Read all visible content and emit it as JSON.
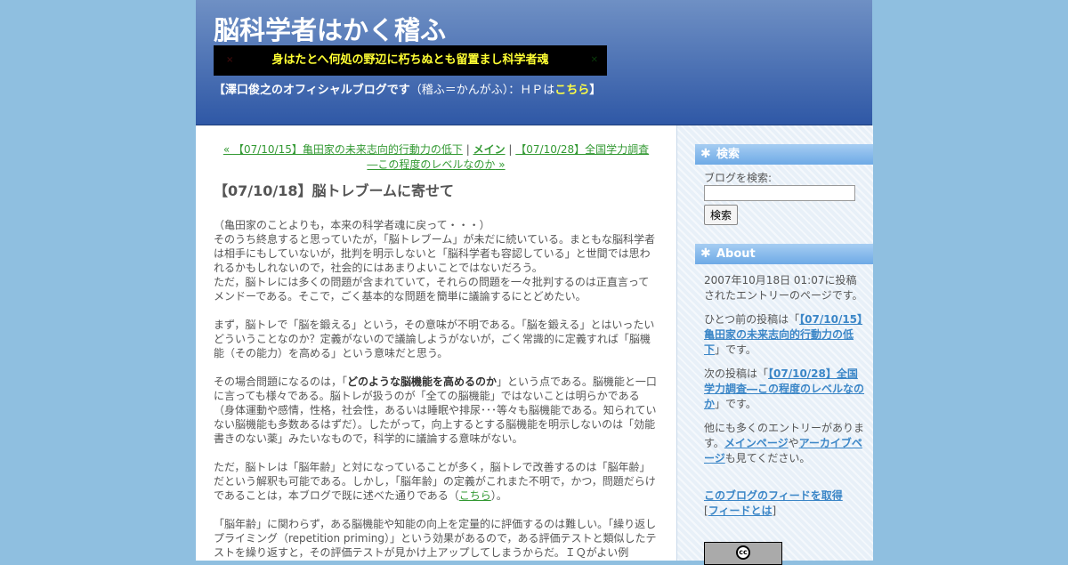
{
  "header": {
    "title": "脳科学者はかく稽ふ",
    "tagline": "身はたとへ何処の野辺に朽ちぬとも留置まし科学者魂",
    "tagline_left_mark": "×",
    "tagline_right_mark": "✕",
    "subtitle_bold": "【澤口俊之のオフィシャルブログです",
    "subtitle_text": "（稽ふ＝かんがふ）：ＨＰは",
    "subtitle_link": "こちら",
    "subtitle_end": "】"
  },
  "entry_nav": {
    "prev_prefix": "« ",
    "prev": "【07/10/15】亀田家の未来志向的行動力の低下",
    "sep1": " | ",
    "main": "メイン",
    "sep2": " | ",
    "next": "【07/10/28】全国学力調査―この程度のレベルなのか",
    "next_suffix": " »"
  },
  "entry": {
    "title": "【07/10/18】脳トレブームに寄せて",
    "p1": "（亀田家のことよりも，本来の科学者魂に戻って・・・）\nそのうち終息すると思っていたが，「脳トレブーム」が未だに続いている。まともな脳科学者は相手にもしていないが，批判を明示しないと「脳科学者も容認している」と世間では思われるかもしれないので，社会的にはあまりよいことではないだろう。\nただ，脳トレには多くの問題が含まれていて，それらの問題を一々批判するのは正直言ってメンドーである。そこで，ごく基本的な問題を簡単に議論するにとどめたい。",
    "p2": "まず，脳トレで「脳を鍛える」という，その意味が不明である。「脳を鍛える」とはいったいどういうことなのか？定義がないので議論しようがないが，ごく常識的に定義すれば「脳機能（その能力）を高める」という意味だと思う。",
    "p3_a": "その場合問題になるのは，「",
    "p3_bold": "どのような脳機能を高めるのか",
    "p3_b": "」という点である。脳機能と一口に言っても様々である。脳トレが扱うのが「全ての脳機能」ではないことは明らかである（身体運動や感情，性格，社会性，あるいは睡眠や排尿･･･等々も脳機能である。知られていない脳機能も多数あるはずだ）。したがって，向上するとする脳機能を明示しないのは「効能書きのない薬」みたいなもので，科学的に議論する意味がない。",
    "p4_a": "ただ，脳トレは「脳年齢」と対になっていることが多く，脳トレで改善するのは「脳年齢」だという解釈も可能である。しかし，「脳年齢」の定義がこれまた不明で，かつ，問題だらけであることは，本ブログで既に述べた通りである（",
    "p4_link": "こちら",
    "p4_b": "）。",
    "p5": "「脳年齢」に関わらず，ある脳機能や知能の向上を定量的に評価するのは難しい。「繰り返しプライミング（repetition priming）」という効果があるので，ある評価テストと類似したテストを繰り返すと，その評価テストが見かけ上アップしてしまうからだ。ＩＱがよい例"
  },
  "sidebar": {
    "search_heading": "検索",
    "search_label": "ブログを検索:",
    "search_value": "",
    "search_button": "検索",
    "about_heading": "About",
    "about_p1": "2007年10月18日 01:07に投稿されたエントリーのページです。",
    "about_p2_a": "ひとつ前の投稿は「",
    "about_p2_link": "【07/10/15】亀田家の未来志向的行動力の低下",
    "about_p2_b": "」です。",
    "about_p3_a": "次の投稿は「",
    "about_p3_link": "【07/10/28】全国学力調査―この程度のレベルなのか",
    "about_p3_b": "」です。",
    "about_p4_a": "他にも多くのエントリーがあります。",
    "about_p4_link1": "メインページ",
    "about_p4_mid": "や",
    "about_p4_link2": "アーカイブページ",
    "about_p4_b": "も見てください。",
    "feed_link": "このブログのフィードを取得",
    "feed_bracket_open": "[",
    "feed_what": "フィードとは",
    "feed_bracket_close": "]",
    "cc_mark": "cc"
  },
  "colors": {
    "page_bg": "#8fbfe0",
    "banner_top": "#6f90c4",
    "banner_bottom": "#2f58a6",
    "tagline_text": "#ffff33",
    "content_link": "#339933",
    "sidebar_link": "#3b86c7",
    "sidebar_heading": "#6eaae6"
  },
  "icons": {
    "sidebar_heading_icon": "asterisk-icon",
    "license_icon": "creative-commons-icon"
  }
}
